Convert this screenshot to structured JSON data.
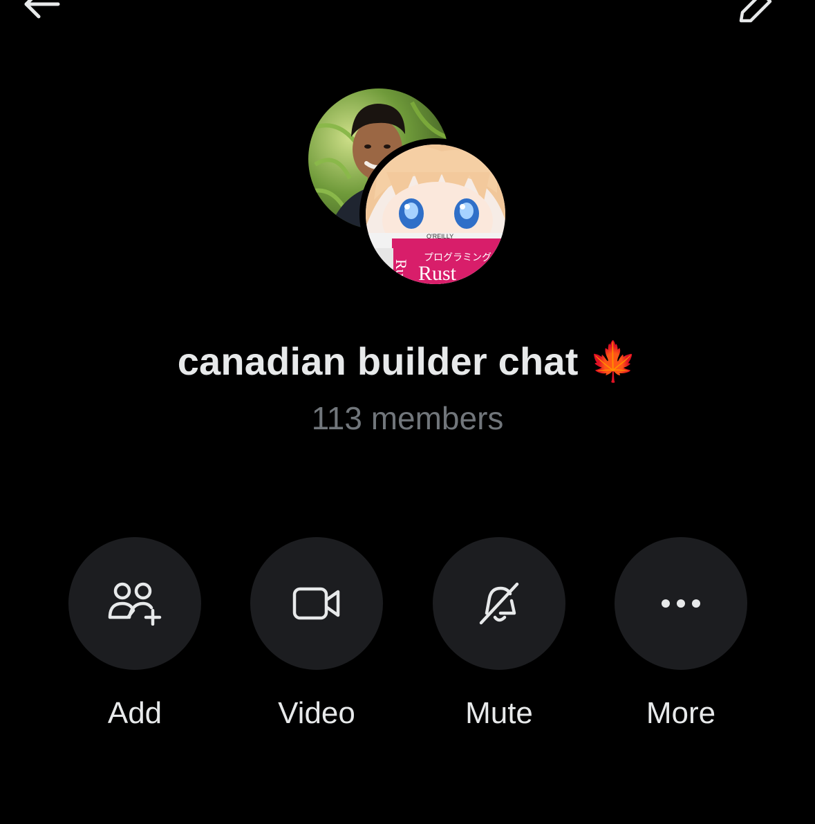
{
  "header": {
    "back_icon": "arrow-left-icon",
    "edit_icon": "pencil-icon"
  },
  "group": {
    "title": "canadian builder chat 🍁",
    "members": "113 members",
    "avatars": [
      "member-photo-avatar",
      "anime-rust-book-avatar"
    ],
    "avatar_book_text": [
      "O'REILLY",
      "プログラミング",
      "Rust",
      "Rust"
    ]
  },
  "actions": [
    {
      "label": "Add",
      "icon": "add-people-icon"
    },
    {
      "label": "Video",
      "icon": "video-camera-icon"
    },
    {
      "label": "Mute",
      "icon": "bell-off-icon"
    },
    {
      "label": "More",
      "icon": "more-dots-icon"
    }
  ],
  "colors": {
    "background": "#000000",
    "text_primary": "#e7e9ea",
    "text_secondary": "#71767b",
    "action_circle": "#1c1d20"
  }
}
